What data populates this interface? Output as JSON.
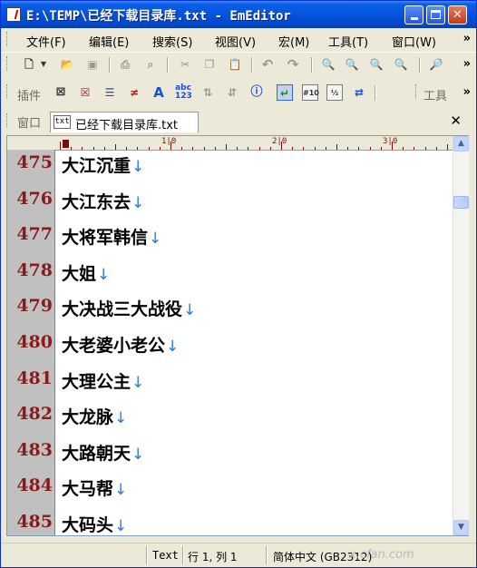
{
  "window": {
    "title": "E:\\TEMP\\已经下载目录库.txt - EmEditor"
  },
  "menu": [
    "文件(F)",
    "编辑(E)",
    "搜索(S)",
    "视图(V)",
    "宏(M)",
    "工具(T)",
    "窗口(W)"
  ],
  "toolbar2": {
    "left_label": "插件",
    "right_label": "工具"
  },
  "tabs": {
    "group_label": "窗口",
    "active_tab": "已经下载目录库.txt",
    "tab_icon_text": "txt",
    "close_symbol": "✕"
  },
  "ruler": {
    "marks": [
      "1|0",
      "2|0",
      "3|0"
    ]
  },
  "editor": {
    "lines": [
      {
        "num": "475",
        "text": "大江沉重"
      },
      {
        "num": "476",
        "text": "大江东去"
      },
      {
        "num": "477",
        "text": "大将军韩信"
      },
      {
        "num": "478",
        "text": "大姐"
      },
      {
        "num": "479",
        "text": "大决战三大战役"
      },
      {
        "num": "480",
        "text": "大老婆小老公"
      },
      {
        "num": "481",
        "text": "大理公主"
      },
      {
        "num": "482",
        "text": "大龙脉"
      },
      {
        "num": "483",
        "text": "大路朝天"
      },
      {
        "num": "484",
        "text": "大马帮"
      },
      {
        "num": "485",
        "text": "大码头"
      }
    ],
    "newline_glyph": "↓"
  },
  "status": {
    "mode": "Text",
    "position": "行 1, 列 1",
    "encoding": "简体中文 (GB2312)",
    "watermark": "x.cfan.com"
  }
}
